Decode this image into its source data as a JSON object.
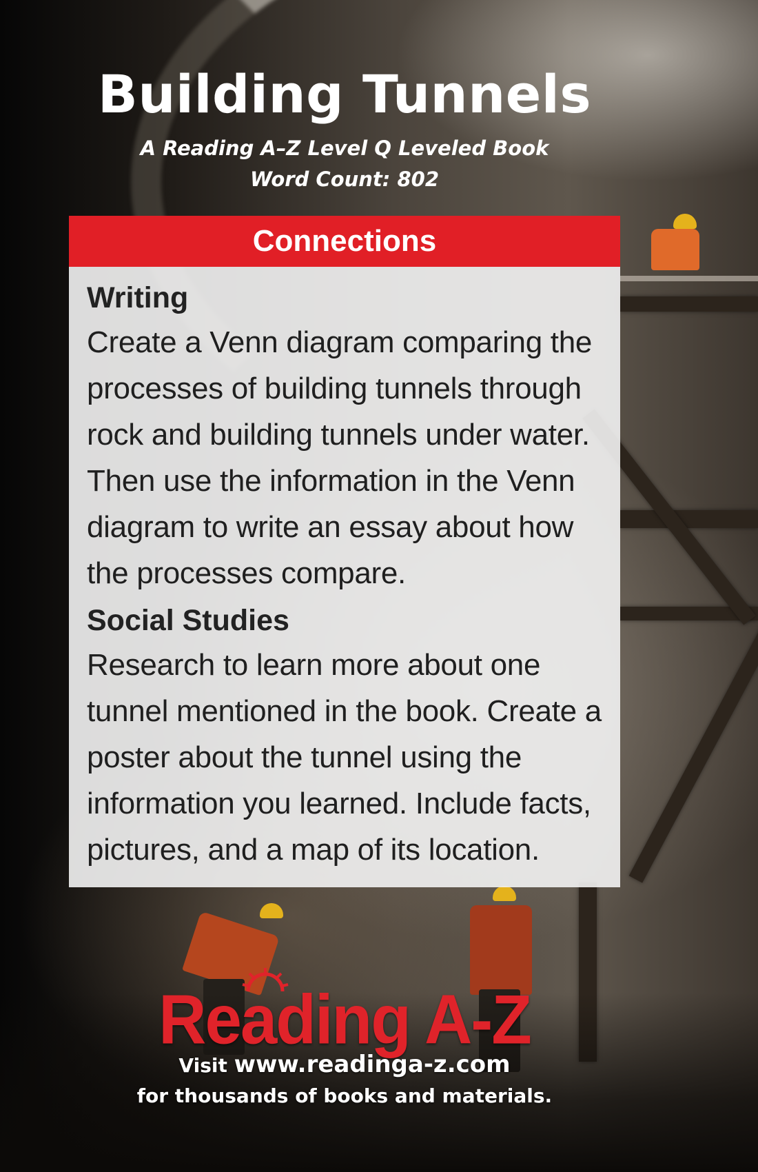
{
  "title": "Building Tunnels",
  "subtitle": "A Reading A–Z Level Q Leveled Book",
  "word_count": "Word Count: 802",
  "connections": {
    "header": "Connections",
    "sections": [
      {
        "heading": "Writing",
        "text": "Create a Venn diagram comparing the processes of building tunnels through rock and building tunnels under water. Then use the information in the Venn diagram to write an essay about how the processes compare."
      },
      {
        "heading": "Social Studies",
        "text": "Research to learn more about one tunnel mentioned in the book. Create a poster about the tunnel using the information you learned. Include facts, pictures, and a map of its location."
      }
    ]
  },
  "logo": {
    "text": "Reading A-Z",
    "color": "#e0232a"
  },
  "footer": {
    "visit_prefix": "Visit ",
    "url": "www.readinga-z.com",
    "line2": "for thousands of books and materials."
  },
  "colors": {
    "header_red": "#e11f26",
    "text_white": "#ffffff"
  }
}
